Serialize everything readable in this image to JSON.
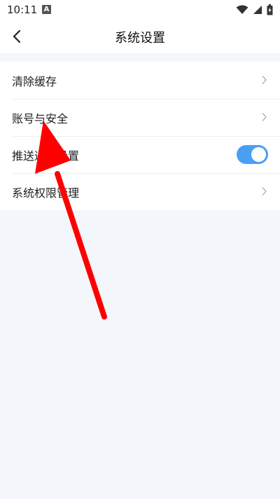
{
  "status_bar": {
    "time": "10:11",
    "notification_icon": "a-letter-icon",
    "wifi_icon": "wifi-icon",
    "signal_icon": "signal-icon",
    "battery_icon": "battery-charging-icon"
  },
  "nav": {
    "title": "系统设置",
    "back_icon": "chevron-left-icon"
  },
  "settings": {
    "items": [
      {
        "label": "清除缓存",
        "control": "chevron"
      },
      {
        "label": "账号与安全",
        "control": "chevron"
      },
      {
        "label": "推送通知设置",
        "control": "toggle",
        "toggle_on": true
      },
      {
        "label": "系统权限管理",
        "control": "chevron"
      }
    ]
  },
  "colors": {
    "toggle_on": "#4a9ff5",
    "page_background": "#f3f6fb",
    "annotation_arrow": "#ff0000"
  }
}
